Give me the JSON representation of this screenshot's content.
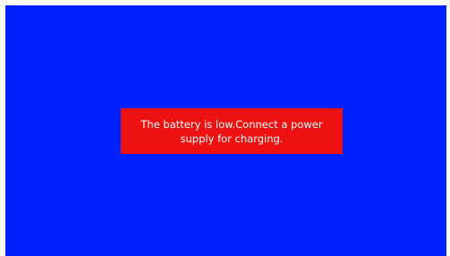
{
  "colors": {
    "screen_background": "#0022ff",
    "alert_background": "#ee1111",
    "alert_text": "#ffffff"
  },
  "alert": {
    "message": "The battery is low.Connect a power supply for charging."
  }
}
